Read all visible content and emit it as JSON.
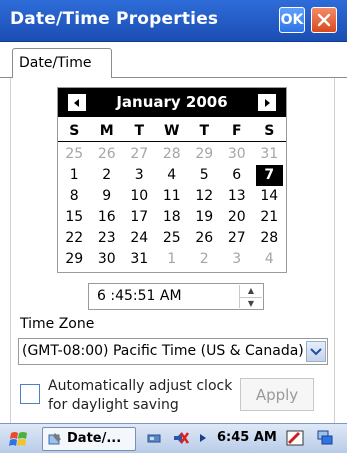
{
  "window": {
    "title": "Date/Time Properties",
    "ok_label": "OK"
  },
  "tabs": [
    {
      "label": "Date/Time"
    }
  ],
  "calendar": {
    "month_year": "January 2006",
    "days_of_week": [
      "S",
      "M",
      "T",
      "W",
      "T",
      "F",
      "S"
    ],
    "weeks": [
      [
        {
          "d": "25",
          "o": true
        },
        {
          "d": "26",
          "o": true
        },
        {
          "d": "27",
          "o": true
        },
        {
          "d": "28",
          "o": true
        },
        {
          "d": "29",
          "o": true
        },
        {
          "d": "30",
          "o": true
        },
        {
          "d": "31",
          "o": true
        }
      ],
      [
        {
          "d": "1"
        },
        {
          "d": "2"
        },
        {
          "d": "3"
        },
        {
          "d": "4"
        },
        {
          "d": "5"
        },
        {
          "d": "6"
        },
        {
          "d": "7",
          "sel": true
        }
      ],
      [
        {
          "d": "8"
        },
        {
          "d": "9"
        },
        {
          "d": "10"
        },
        {
          "d": "11"
        },
        {
          "d": "12"
        },
        {
          "d": "13"
        },
        {
          "d": "14"
        }
      ],
      [
        {
          "d": "15"
        },
        {
          "d": "16"
        },
        {
          "d": "17"
        },
        {
          "d": "18"
        },
        {
          "d": "19"
        },
        {
          "d": "20"
        },
        {
          "d": "21"
        }
      ],
      [
        {
          "d": "22"
        },
        {
          "d": "23"
        },
        {
          "d": "24"
        },
        {
          "d": "25"
        },
        {
          "d": "26"
        },
        {
          "d": "27"
        },
        {
          "d": "28"
        }
      ],
      [
        {
          "d": "29"
        },
        {
          "d": "30"
        },
        {
          "d": "31"
        },
        {
          "d": "1",
          "o": true
        },
        {
          "d": "2",
          "o": true
        },
        {
          "d": "3",
          "o": true
        },
        {
          "d": "4",
          "o": true
        }
      ]
    ],
    "selected_day": "7"
  },
  "time": {
    "value": "6 :45:51 AM"
  },
  "time_zone": {
    "label": "Time Zone",
    "value": "(GMT-08:00) Pacific Time (US & Canada)"
  },
  "dst": {
    "label": "Automatically adjust clock for daylight saving",
    "checked": false
  },
  "apply_label": "Apply",
  "taskbar": {
    "active_task": "Date/...",
    "clock": "6:45 AM"
  },
  "colors": {
    "title_bar": "#1b4eb3",
    "calendar_header": "#000000",
    "ok_button": "#2f74e6",
    "close_button": "#d9491d"
  },
  "icons": {
    "start": "windows-flag-icon",
    "task": "control-panel-icon",
    "tray": [
      "connectivity-icon",
      "volume-muted-icon",
      "pen-icon",
      "windows-switch-icon"
    ]
  }
}
